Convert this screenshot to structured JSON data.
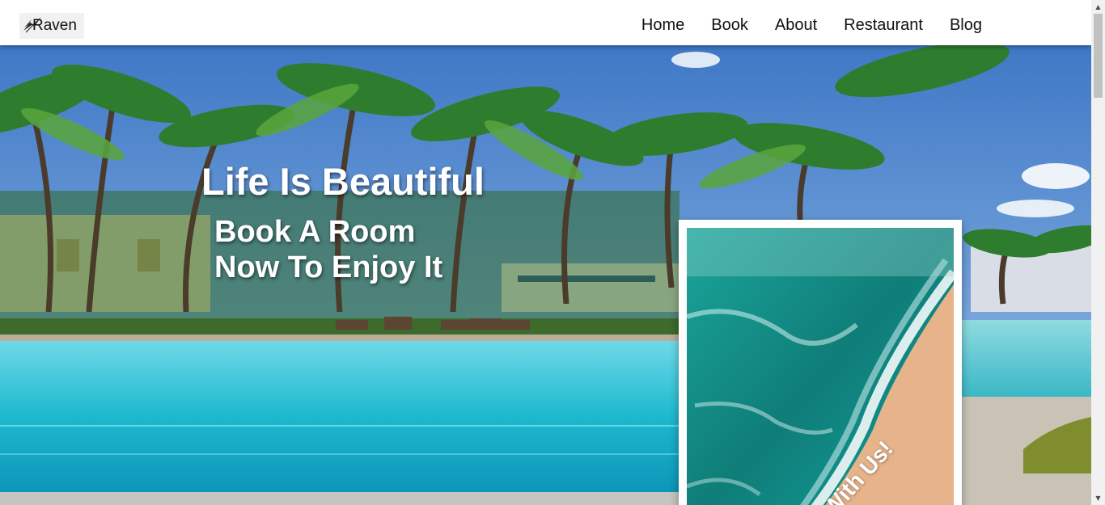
{
  "brand": {
    "name": "Raven"
  },
  "nav": {
    "items": [
      {
        "label": "Home"
      },
      {
        "label": "Book"
      },
      {
        "label": "About"
      },
      {
        "label": "Restaurant"
      },
      {
        "label": "Blog"
      }
    ]
  },
  "hero": {
    "headline": "Life Is Beautiful",
    "subline_1": "Book A Room",
    "subline_2": "Now To Enjoy It",
    "card_caption": "With Us!"
  },
  "scrollbar": {
    "up_icon": "▲",
    "down_icon": "▼"
  },
  "colors": {
    "nav_bg": "#ffffff",
    "nav_text": "#111111",
    "hero_text": "#ffffff"
  }
}
